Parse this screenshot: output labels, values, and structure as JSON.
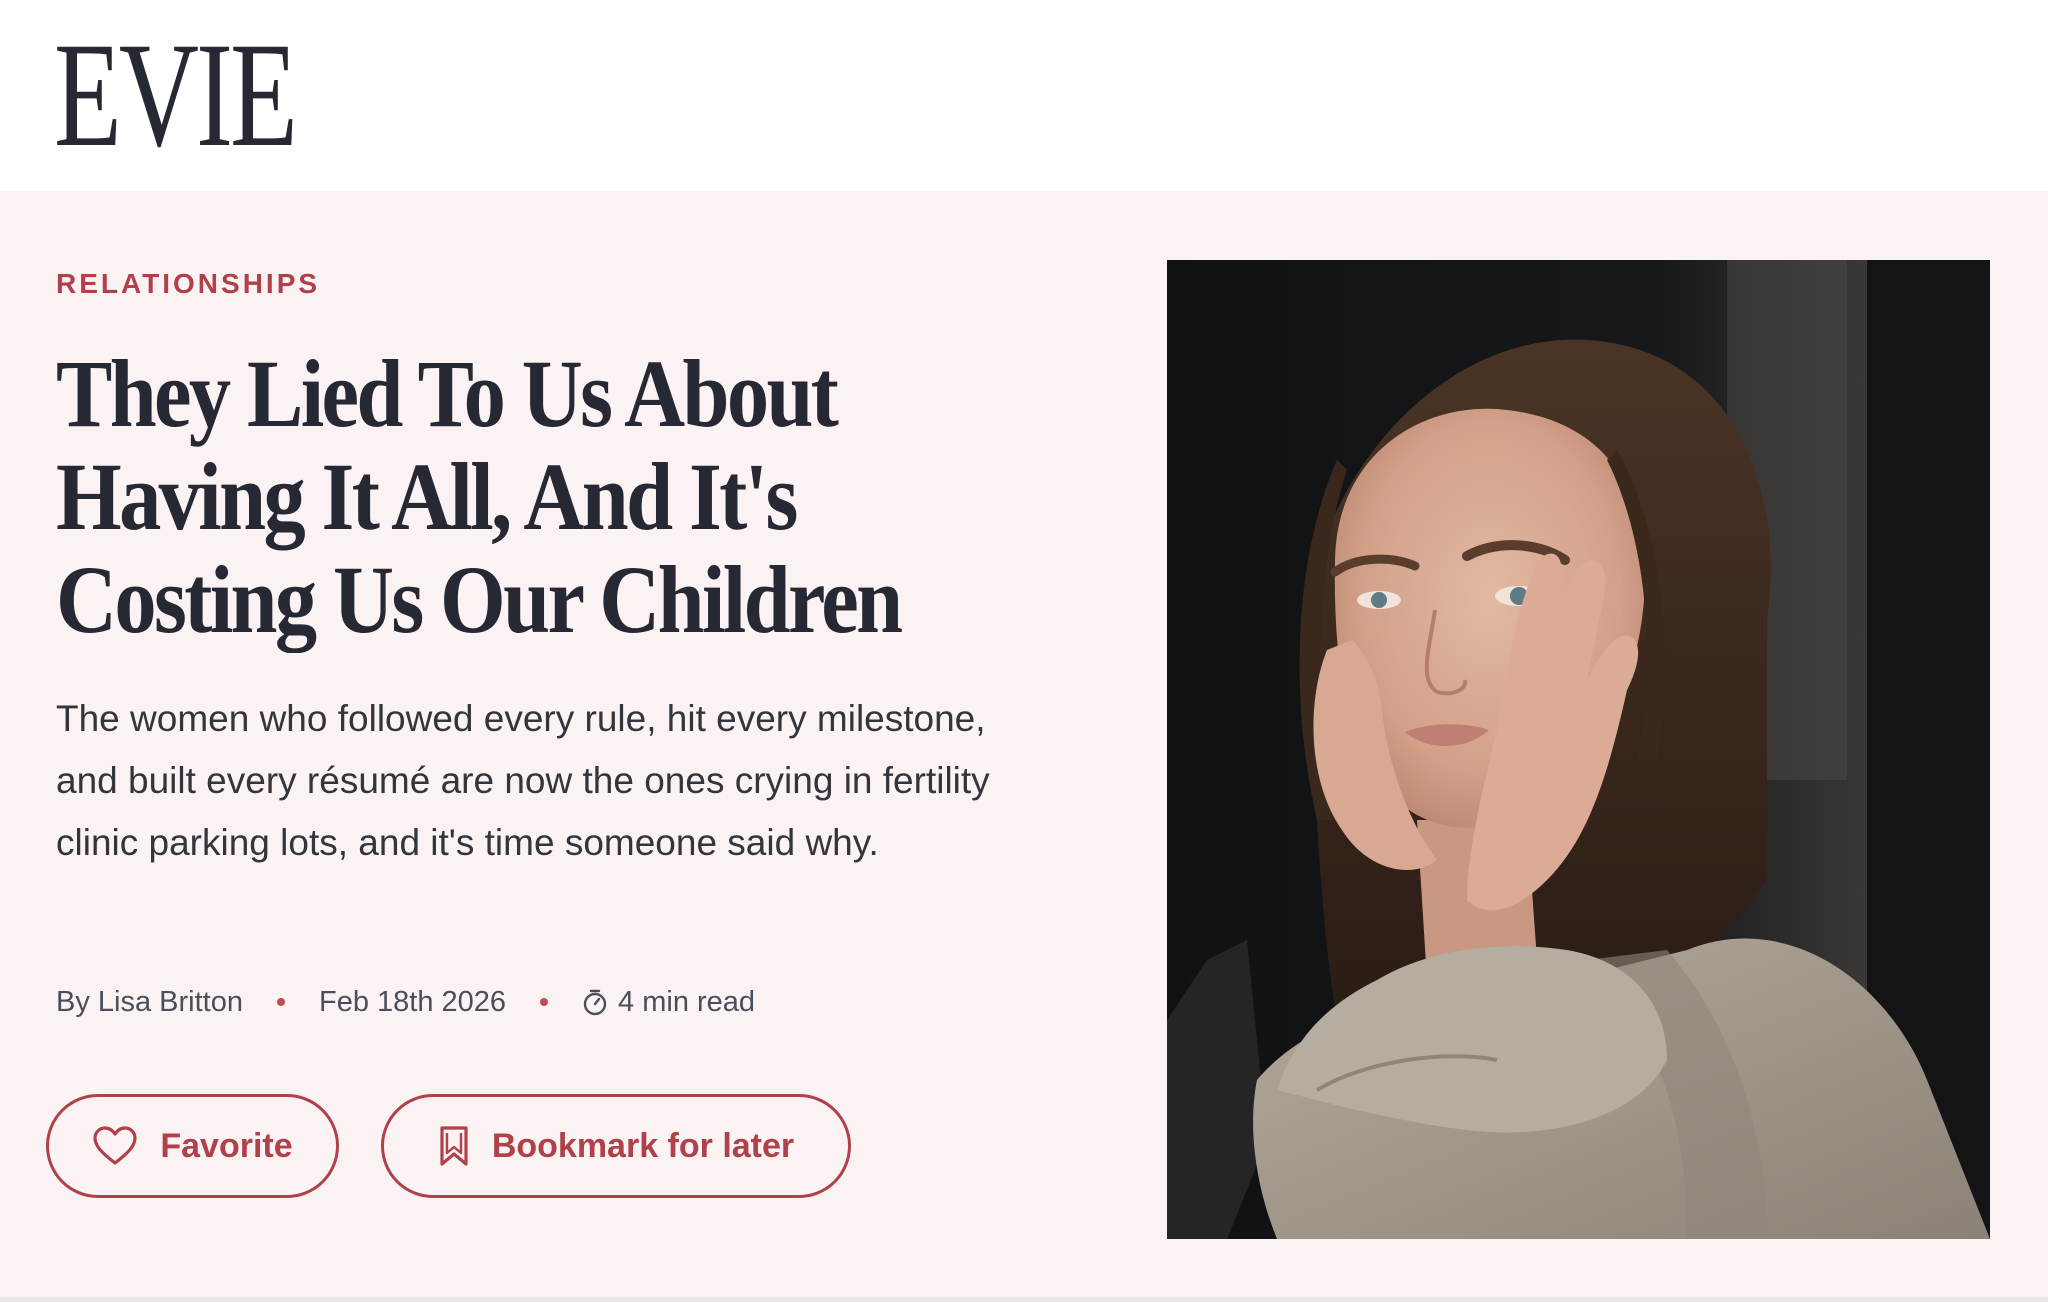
{
  "site": {
    "logo": "EVIE"
  },
  "article": {
    "category": "RELATIONSHIPS",
    "headline": "They Lied To Us About Having It All, And It's Costing Us Our Children",
    "dek": "The women who followed every rule, hit every milestone, and built every résumé are now the ones crying in fertility clinic parking lots, and it's time someone said why.",
    "byline": "By Lisa Britton",
    "date": "Feb 18th 2026",
    "read_time": "4 min read",
    "read_time_icon": "stopwatch-icon"
  },
  "actions": {
    "favorite_label": "Favorite",
    "favorite_icon": "heart-icon",
    "bookmark_label": "Bookmark for later",
    "bookmark_icon": "bookmark-icon"
  },
  "hero_image": {
    "subject": "woman-resting-face-in-hands-photo"
  },
  "colors": {
    "accent": "#b0404a",
    "hero_background": "#fbf3f3",
    "text": "#262833"
  }
}
